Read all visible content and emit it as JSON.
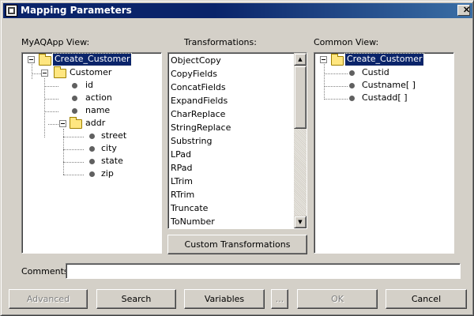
{
  "window": {
    "title": "Mapping Parameters",
    "close_glyph": "✕"
  },
  "left_panel": {
    "label": "MyAQApp View:",
    "tree": [
      {
        "text": "Create_Customer",
        "icon": "folder-icon",
        "selected": true
      },
      {
        "text": "Customer",
        "icon": "folder-icon"
      },
      {
        "text": "id",
        "icon": "leaf-icon"
      },
      {
        "text": "action",
        "icon": "leaf-icon"
      },
      {
        "text": "name",
        "icon": "leaf-icon"
      },
      {
        "text": "addr",
        "icon": "folder-icon"
      },
      {
        "text": "street",
        "icon": "leaf-icon"
      },
      {
        "text": "city",
        "icon": "leaf-icon"
      },
      {
        "text": "state",
        "icon": "leaf-icon"
      },
      {
        "text": "zip",
        "icon": "leaf-icon"
      }
    ]
  },
  "middle_panel": {
    "label": "Transformations:",
    "items": [
      "ObjectCopy",
      "CopyFields",
      "ConcatFields",
      "ExpandFields",
      "CharReplace",
      "StringReplace",
      "Substring",
      "LPad",
      "RPad",
      "LTrim",
      "RTrim",
      "Truncate",
      "ToNumber"
    ],
    "custom_button": "Custom Transformations"
  },
  "right_panel": {
    "label": "Common View:",
    "tree": [
      {
        "text": "Create_Customer",
        "icon": "folder-icon",
        "selected": true
      },
      {
        "text": "Custid",
        "icon": "leaf-icon"
      },
      {
        "text": "Custname[ ]",
        "icon": "leaf-icon"
      },
      {
        "text": "Custadd[ ]",
        "icon": "leaf-icon"
      }
    ]
  },
  "comments": {
    "label": "Comments",
    "value": ""
  },
  "buttons": {
    "advanced": "Advanced",
    "search": "Search",
    "variables": "Variables",
    "ellipsis": "...",
    "ok": "OK",
    "cancel": "Cancel"
  }
}
